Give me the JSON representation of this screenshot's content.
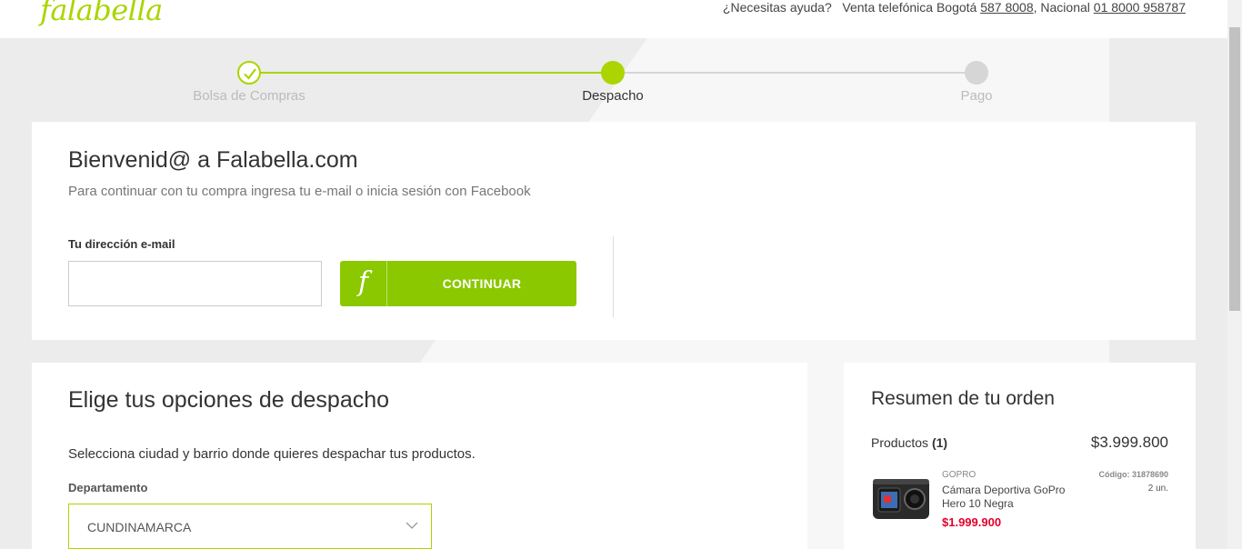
{
  "header": {
    "logo": "falabella",
    "help_prefix": "¿Necesitas ayuda?",
    "sales_label": "Venta telefónica Bogotá",
    "bogota_phone": "587 8008",
    "national_label": ", Nacional",
    "national_phone": "01 8000 958787"
  },
  "steps": [
    {
      "label": "Bolsa de Compras",
      "state": "done"
    },
    {
      "label": "Despacho",
      "state": "active"
    },
    {
      "label": "Pago",
      "state": "pending"
    }
  ],
  "login": {
    "title": "Bienvenid@ a Falabella.com",
    "subtitle": "Para continuar con tu compra ingresa tu e-mail o inicia sesión con Facebook",
    "email_label": "Tu dirección e-mail",
    "email_value": "",
    "continue_icon": "f",
    "continue_label": "CONTINUAR"
  },
  "shipping": {
    "title": "Elige tus opciones de despacho",
    "subtitle": "Selecciona ciudad y barrio donde quieres despachar tus productos.",
    "department_label": "Departamento",
    "department_value": "CUNDINAMARCA"
  },
  "summary": {
    "title": "Resumen de tu orden",
    "products_label": "Productos",
    "products_count": "(1)",
    "total": "$3.999.800",
    "item": {
      "brand": "GOPRO",
      "name": "Cámara Deportiva GoPro Hero 10 Negra",
      "price": "$1.999.900",
      "code": "Código: 31878690",
      "qty": "2 un."
    }
  },
  "colors": {
    "accent": "#aad500",
    "button": "#8bc800",
    "price": "#e4002b"
  }
}
